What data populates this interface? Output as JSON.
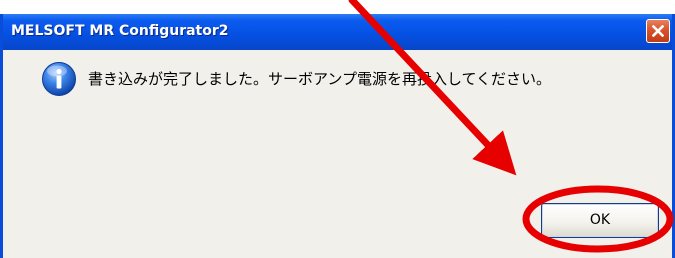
{
  "window": {
    "title": "MELSOFT MR Configurator2"
  },
  "dialog": {
    "icon": "info-icon",
    "message": "書き込みが完了しました。サーボアンプ電源を再投入してください。",
    "ok_label": "OK"
  },
  "annotations": {
    "color": "#e60000"
  }
}
